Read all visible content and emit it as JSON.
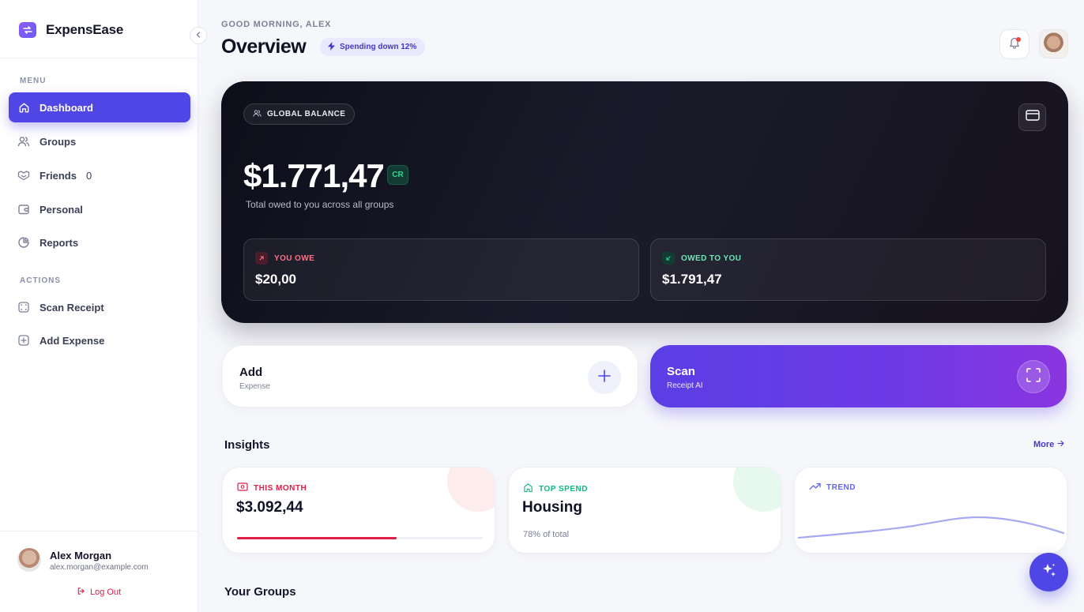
{
  "app": {
    "name": "ExpensEase"
  },
  "sidebar": {
    "menu_label": "MENU",
    "actions_label": "ACTIONS",
    "items": [
      {
        "label": "Dashboard",
        "icon": "home-icon"
      },
      {
        "label": "Groups",
        "icon": "users-icon"
      },
      {
        "label": "Friends",
        "icon": "handshake-icon",
        "count": "0"
      },
      {
        "label": "Personal",
        "icon": "wallet-icon"
      },
      {
        "label": "Reports",
        "icon": "pie-chart-icon"
      }
    ],
    "actions": [
      {
        "label": "Scan Receipt",
        "icon": "scan-icon"
      },
      {
        "label": "Add Expense",
        "icon": "plus-square-icon"
      }
    ],
    "user": {
      "name": "Alex Morgan",
      "email": "alex.morgan@example.com"
    },
    "logout_label": "Log Out"
  },
  "header": {
    "greeting": "GOOD MORNING, ALEX",
    "title": "Overview",
    "trend_pill": "Spending down 12%"
  },
  "balance": {
    "pill_label": "GLOBAL BALANCE",
    "amount": "$1.771,47",
    "badge": "CR",
    "subtitle": "Total owed to you across all groups",
    "you_owe_label": "YOU OWE",
    "you_owe_value": "$20,00",
    "owed_to_you_label": "OWED TO YOU",
    "owed_to_you_value": "$1.791,47"
  },
  "actions": {
    "add_title": "Add",
    "add_subtitle": "Expense",
    "scan_title": "Scan",
    "scan_subtitle": "Receipt AI"
  },
  "insights": {
    "title": "Insights",
    "more_label": "More",
    "this_month_label": "THIS MONTH",
    "this_month_value": "$3.092,44",
    "this_month_progress": 0.65,
    "top_spend_label": "TOP SPEND",
    "top_spend_value": "Housing",
    "top_spend_note": "78% of total",
    "trend_label": "TREND"
  },
  "groups": {
    "title": "Your Groups"
  },
  "colors": {
    "accent": "#4f46e5",
    "danger": "#e11d48",
    "success": "#10b981"
  }
}
